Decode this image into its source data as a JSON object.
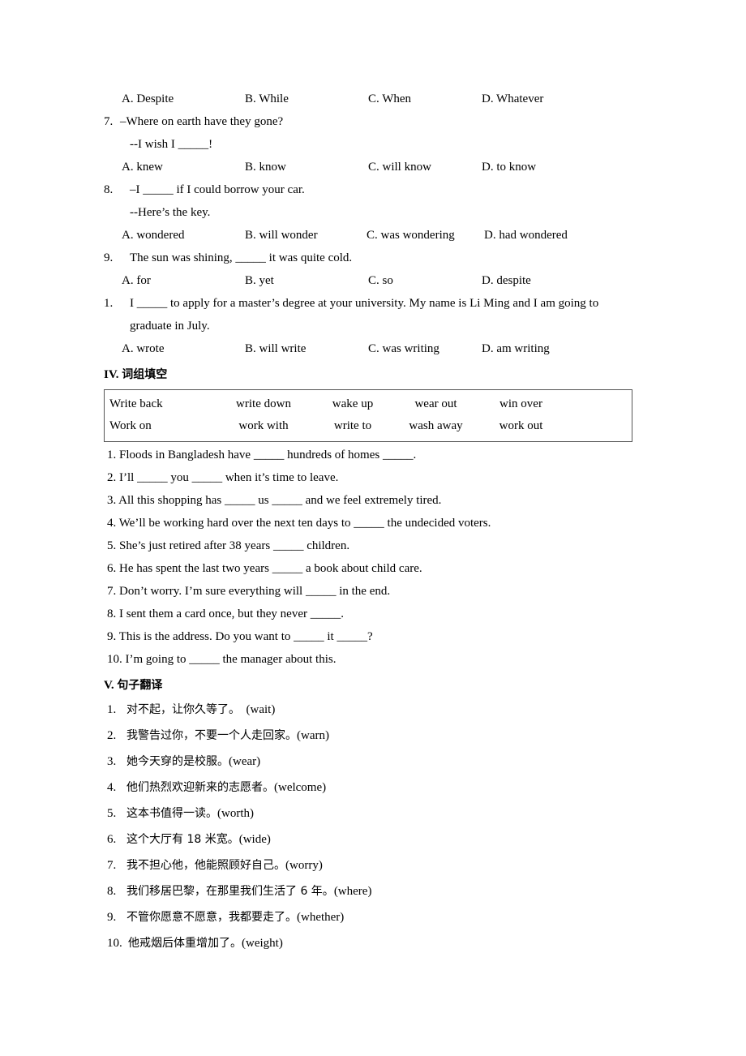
{
  "multiple_choice": {
    "orphan_options_row": {
      "a": "A. Despite",
      "b": "B. While",
      "c": "C. When",
      "d": "D. Whatever"
    },
    "questions": [
      {
        "number": "7.",
        "stem": "–Where on earth have they gone?",
        "reply": "--I wish I _____!",
        "options": {
          "a": "A. knew",
          "b": "B. know",
          "c": "C. will know",
          "d": "D. to know"
        }
      },
      {
        "number": "8.",
        "stem": "–I _____ if I could borrow your car.",
        "reply": "--Here’s the key.",
        "options": {
          "a": "A. wondered",
          "b": "B. will wonder",
          "c": "C. was wondering",
          "d": "D. had wondered"
        }
      },
      {
        "number": "9.",
        "stem": "The sun was shining, _____ it was quite cold.",
        "reply": "",
        "options": {
          "a": "A. for",
          "b": "B. yet",
          "c": "C. so",
          "d": "D. despite"
        }
      },
      {
        "number": "1.",
        "stem": "I _____ to apply for a master’s degree at your university. My name is Li Ming and I am going to",
        "continuation": "graduate in July.",
        "reply": "",
        "options": {
          "a": "A. wrote",
          "b": "B. will write",
          "c": "C. was writing",
          "d": "D. am writing"
        }
      }
    ]
  },
  "section_phrase_fill": {
    "heading_numeral": "IV.",
    "heading_cn": "词组填空",
    "word_bank": {
      "row1": [
        "Write back",
        "write down",
        "wake up",
        "wear out",
        "win over"
      ],
      "row2": [
        "Work on",
        "work with",
        "write to",
        "wash away",
        "work out"
      ]
    },
    "items": [
      "1. Floods in Bangladesh have _____ hundreds of homes _____.",
      "2. I’ll _____ you _____ when it’s time to leave.",
      "3. All this shopping has _____ us _____ and we feel extremely tired.",
      "4. We’ll be working hard over the next ten days to _____ the undecided voters.",
      "5. She’s just retired after 38 years _____ children.",
      "6. He has spent the last two years _____ a book about child care.",
      "7. Don’t worry. I’m sure everything will _____ in the end.",
      "8. I sent them a card once, but they never _____.",
      "9. This is the address. Do you want to _____ it _____?",
      "10. I’m going to _____ the manager about this."
    ]
  },
  "section_translation": {
    "heading_numeral": "V.",
    "heading_cn": "句子翻译",
    "items": [
      {
        "number": "1.",
        "cn": "对不起，让你久等了。",
        "hint": "(wait)",
        "gap": "  "
      },
      {
        "number": "2.",
        "cn": "我警告过你，不要一个人走回家。",
        "hint": "(warn)",
        "gap": ""
      },
      {
        "number": "3.",
        "cn": "她今天穿的是校服。",
        "hint": "(wear)",
        "gap": ""
      },
      {
        "number": "4.",
        "cn": "他们热烈欢迎新来的志愿者。",
        "hint": "(welcome)",
        "gap": ""
      },
      {
        "number": "5.",
        "cn": "这本书值得一读。",
        "hint": "(worth)",
        "gap": ""
      },
      {
        "number": "6.",
        "cn": "这个大厅有 18 米宽。",
        "hint": "(wide)",
        "gap": ""
      },
      {
        "number": "7.",
        "cn": "我不担心他，他能照顾好自己。",
        "hint": "(worry)",
        "gap": ""
      },
      {
        "number": "8.",
        "cn": "我们移居巴黎，在那里我们生活了 6 年。",
        "hint": "(where)",
        "gap": ""
      },
      {
        "number": "9.",
        "cn": "不管你愿意不愿意，我都要走了。",
        "hint": "(whether)",
        "gap": ""
      },
      {
        "number": "10.",
        "cn": "他戒烟后体重增加了。",
        "hint": "(weight)",
        "gap": "",
        "tight": true
      }
    ]
  }
}
